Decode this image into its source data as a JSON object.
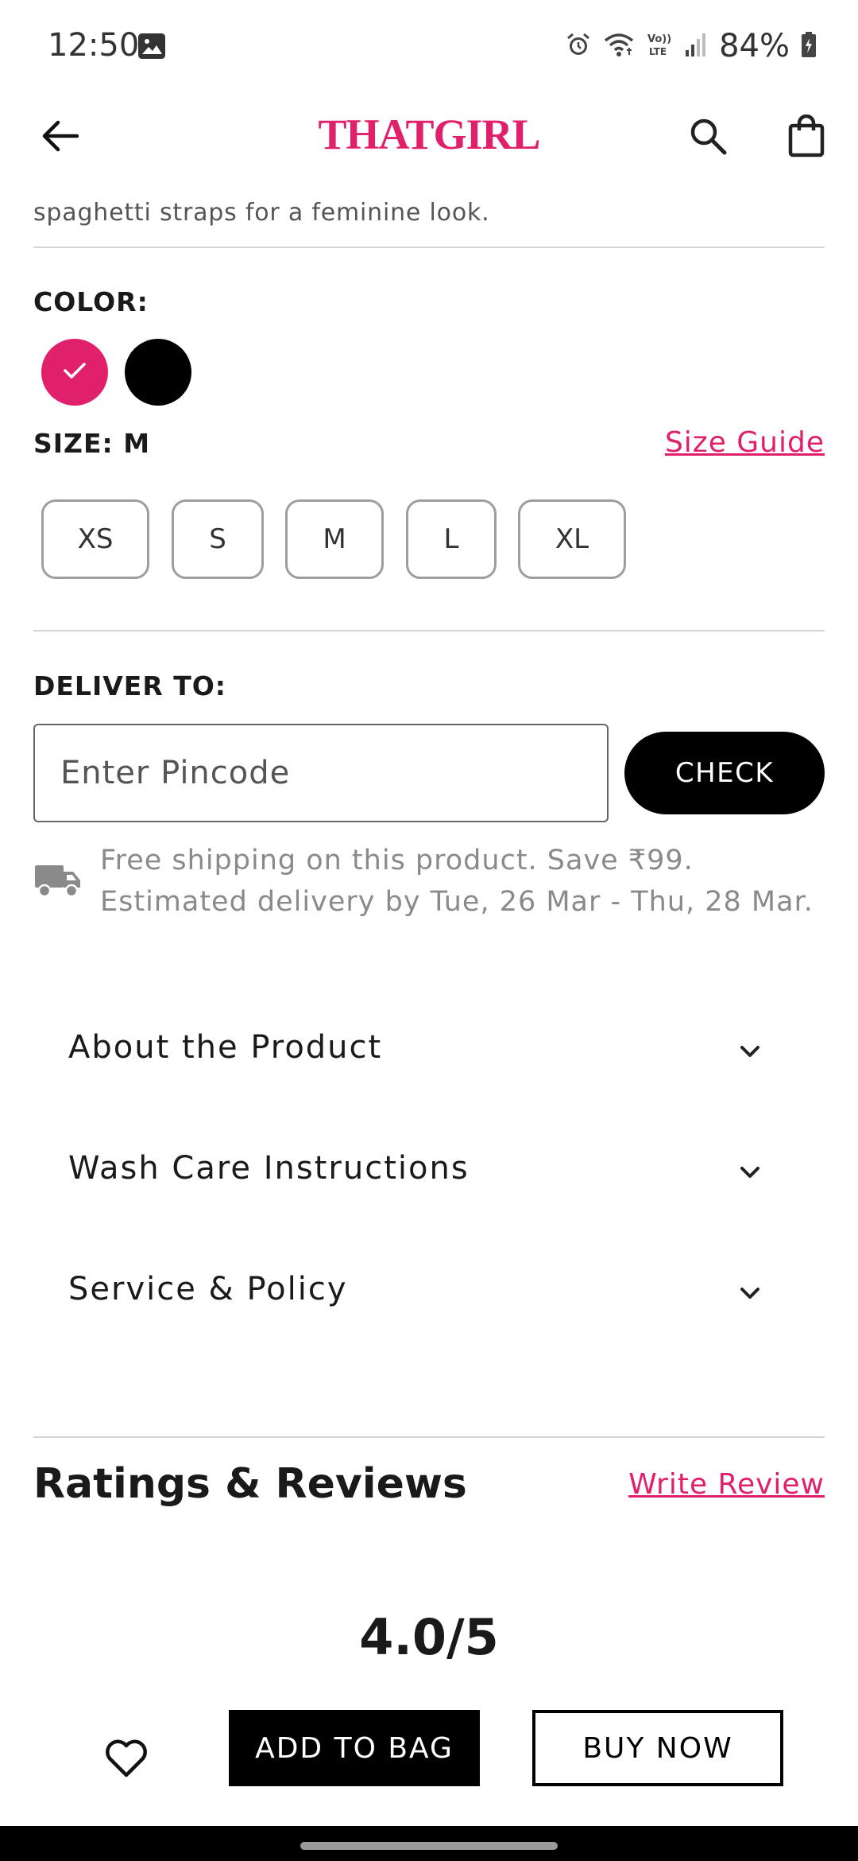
{
  "status_bar": {
    "time": "12:50",
    "battery": "84%",
    "icons": [
      "image-icon",
      "alarm-icon",
      "wifi-icon",
      "volte-icon",
      "signal-icon",
      "battery-icon"
    ]
  },
  "header": {
    "brand": "THATGIRL",
    "brand_color": "#e0206b",
    "icons": [
      "back-arrow-icon",
      "search-icon",
      "shopping-bag-icon"
    ]
  },
  "description": {
    "visible_text": "spaghetti straps for a feminine look."
  },
  "color": {
    "label": "COLOR:",
    "swatches": [
      {
        "name": "pink",
        "hex": "#e0206b",
        "selected": true
      },
      {
        "name": "black",
        "hex": "#000000",
        "selected": false
      }
    ]
  },
  "size": {
    "label": "SIZE:",
    "selected": "M",
    "guide_label": "Size Guide",
    "options": [
      "XS",
      "S",
      "M",
      "L",
      "XL"
    ]
  },
  "delivery": {
    "label": "DELIVER TO:",
    "pincode_placeholder": "Enter Pincode",
    "pincode_value": "",
    "check_label": "CHECK",
    "shipping_line1": "Free shipping on this product. Save ₹99.",
    "shipping_line2": "Estimated delivery by Tue, 26 Mar - Thu, 28 Mar."
  },
  "accordion": {
    "items": [
      {
        "label": "About the Product"
      },
      {
        "label": "Wash Care Instructions"
      },
      {
        "label": "Service & Policy"
      }
    ]
  },
  "reviews": {
    "title": "Ratings & Reviews",
    "write_label": "Write Review",
    "rating": "4.0/5"
  },
  "actions": {
    "add_to_bag": "ADD TO BAG",
    "buy_now": "BUY NOW"
  }
}
